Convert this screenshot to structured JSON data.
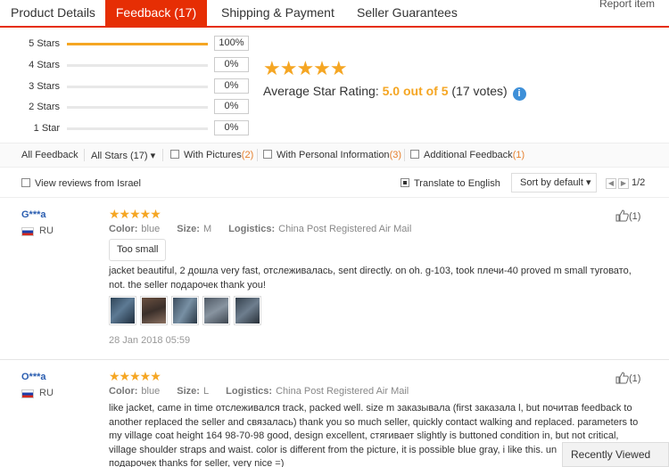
{
  "tabs": {
    "product_details": "Product Details",
    "feedback": "Feedback (17)",
    "shipping": "Shipping & Payment",
    "seller": "Seller Guarantees",
    "report": "Report item"
  },
  "histogram": [
    {
      "label": "5 Stars",
      "pct": "100%",
      "fill": 1.0
    },
    {
      "label": "4 Stars",
      "pct": "0%",
      "fill": 0
    },
    {
      "label": "3 Stars",
      "pct": "0%",
      "fill": 0
    },
    {
      "label": "2 Stars",
      "pct": "0%",
      "fill": 0
    },
    {
      "label": "1 Star",
      "pct": "0%",
      "fill": 0
    }
  ],
  "rating": {
    "stars": "★★★★★",
    "label": "Average Star Rating:",
    "score": "5.0 out of 5",
    "votes": "(17 votes)"
  },
  "filters": {
    "all_feedback": "All Feedback",
    "all_stars": "All Stars (17)",
    "with_pictures": "With Pictures",
    "with_pictures_count": "(2)",
    "personal_info": "With Personal Information",
    "personal_info_count": "(3)",
    "additional": "Additional Feedback",
    "additional_count": "(1)",
    "view_israel": "View reviews from Israel",
    "translate": "Translate to English",
    "sort": "Sort by default",
    "page": "1/2"
  },
  "reviews": [
    {
      "name": "G***a",
      "country": "RU",
      "stars": "★★★★★",
      "color_label": "Color:",
      "color": "blue",
      "size_label": "Size:",
      "size": "M",
      "logistics_label": "Logistics:",
      "logistics": "China Post Registered Air Mail",
      "tag": "Too small",
      "text": "jacket beautiful, 2 дошла very fast, отслеживалась, sent directly. on oh. g-103, took плечи-40 proved m small туговато, not. the seller подарочек thank you!",
      "date": "28 Jan 2018 05:59",
      "likes": "(1)"
    },
    {
      "name": "O***a",
      "country": "RU",
      "stars": "★★★★★",
      "color_label": "Color:",
      "color": "blue",
      "size_label": "Size:",
      "size": "L",
      "logistics_label": "Logistics:",
      "logistics": "China Post Registered Air Mail",
      "text": "like jacket, came in time отслеживался track, packed well. size m заказывала (first заказала l, but почитав feedback to another replaced the seller and связалась) thank you so much seller, quickly contact walking and replaced. parameters to my village coat height 164 98-70-98 good, design excellent, стягивает slightly is buttoned condition in, but not critical, village shoulder straps and waist. color is different from the picture, it is possible blue gray, i like this. un",
      "text_end": "подарочек thanks for seller, very nice =)",
      "likes": "(1)"
    }
  ],
  "recently_viewed": "Recently Viewed",
  "colors": {
    "accent": "#e62e04",
    "star": "#f5a623",
    "link": "#2a5db0"
  }
}
